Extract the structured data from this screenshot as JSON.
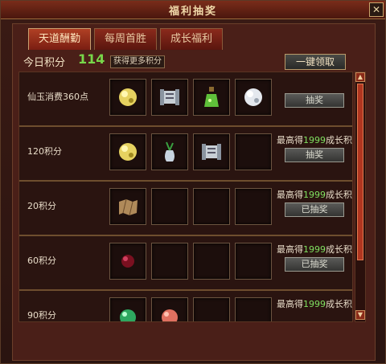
{
  "window": {
    "title": "福利抽奖",
    "close_glyph": "✕"
  },
  "tabs": [
    {
      "label": "天道酬勤",
      "active": true
    },
    {
      "label": "每周首胜",
      "active": false
    },
    {
      "label": "成长福利",
      "active": false
    }
  ],
  "points": {
    "label": "今日积分",
    "value": "114",
    "more_button": "获得更多积分"
  },
  "onekey_button": "一键领取",
  "rows": [
    {
      "label": "仙玉消费360点",
      "max_text": "",
      "max_prefix": "",
      "max_number": "",
      "max_suffix": "",
      "button": "抽奖",
      "icons": [
        "yellow-orb-icon",
        "scroll-icon",
        "green-bottle-icon",
        "white-orb-icon"
      ]
    },
    {
      "label": "120积分",
      "max_prefix": "最高得",
      "max_number": "1999",
      "max_suffix": "成长积分",
      "button": "抽奖",
      "icons": [
        "yellow-orb-icon",
        "vase-icon",
        "scroll-icon",
        "empty-slot"
      ]
    },
    {
      "label": "20积分",
      "max_prefix": "最高得",
      "max_number": "1999",
      "max_suffix": "成长积分",
      "button": "已抽奖",
      "icons": [
        "map-icon",
        "empty-slot",
        "empty-slot",
        "empty-slot"
      ]
    },
    {
      "label": "60积分",
      "max_prefix": "最高得",
      "max_number": "1999",
      "max_suffix": "成长积分",
      "button": "已抽奖",
      "icons": [
        "red-pearl-icon",
        "empty-slot",
        "empty-slot",
        "empty-slot"
      ]
    },
    {
      "label": "90积分",
      "max_prefix": "最高得",
      "max_number": "1999",
      "max_suffix": "成长积分",
      "button": "",
      "icons": [
        "green-gem-icon",
        "peach-icon",
        "empty-slot",
        "empty-slot"
      ]
    }
  ],
  "scrollbar": {
    "up_glyph": "▲",
    "down_glyph": "▼"
  },
  "colors": {
    "accent_green": "#78d84a",
    "tab_active": "#b04024",
    "panel": "#4a1f18"
  }
}
